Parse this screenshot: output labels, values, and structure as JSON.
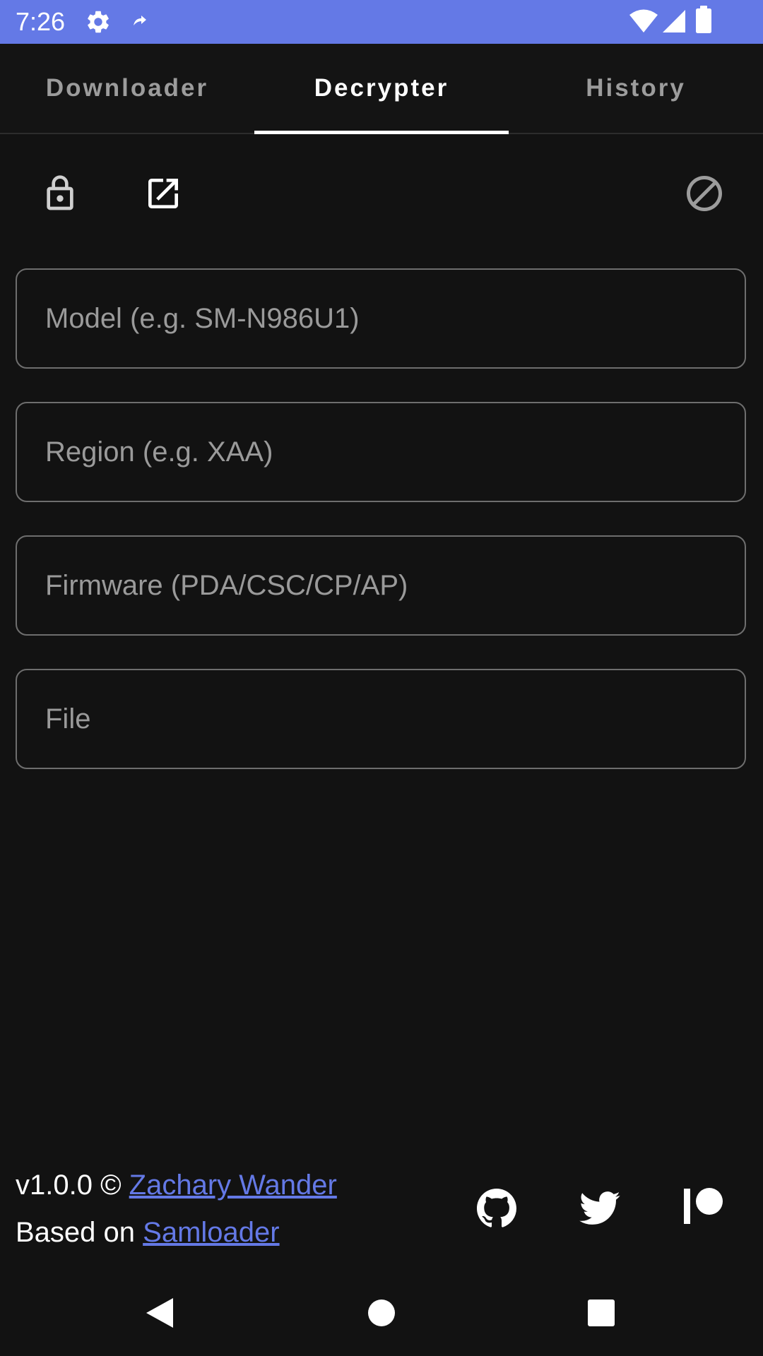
{
  "status_bar": {
    "time": "7:26",
    "icons": [
      "settings-gear-icon",
      "notification-icon",
      "wifi-icon",
      "cell-signal-icon",
      "battery-icon"
    ]
  },
  "tabs": [
    {
      "label": "Downloader",
      "active": false
    },
    {
      "label": "Decrypter",
      "active": true
    },
    {
      "label": "History",
      "active": false
    }
  ],
  "toolbar": {
    "icons": [
      "lock-icon",
      "open-external-icon",
      "cancel-icon"
    ]
  },
  "fields": {
    "model": {
      "placeholder": "Model (e.g. SM-N986U1)",
      "value": ""
    },
    "region": {
      "placeholder": "Region (e.g. XAA)",
      "value": ""
    },
    "firmware": {
      "placeholder": "Firmware (PDA/CSC/CP/AP)",
      "value": ""
    },
    "file": {
      "placeholder": "File",
      "value": ""
    }
  },
  "footer": {
    "version_prefix": "v1.0.0 © ",
    "author": "Zachary Wander",
    "based_prefix": "Based on ",
    "based_link": "Samloader",
    "social_icons": [
      "github-icon",
      "twitter-icon",
      "patreon-icon"
    ]
  },
  "nav": {
    "icons": [
      "back-icon",
      "home-icon",
      "recents-icon"
    ]
  },
  "colors": {
    "accent": "#6479E6",
    "background": "#121212",
    "field_border": "#6e6e6e",
    "placeholder": "#9a9a9a",
    "inactive_tab": "#9c9c9c"
  }
}
